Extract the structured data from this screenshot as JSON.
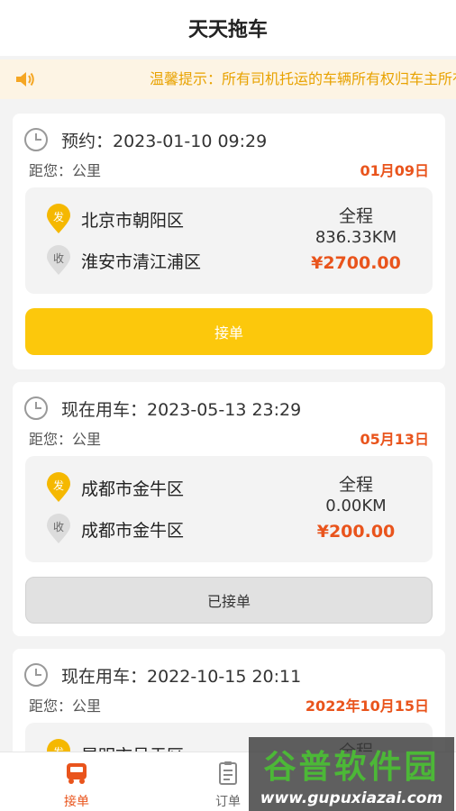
{
  "header": {
    "title": "天天拖车"
  },
  "notice": {
    "icon": "speaker-icon",
    "text": "温馨提示：所有司机托运的车辆所有权归车主所有"
  },
  "orders": [
    {
      "time": "预约：2023-01-10 09:29",
      "distance": "距您：公里",
      "date_badge": "01月09日",
      "from_tag": "发",
      "from": "北京市朝阳区",
      "to_tag": "收",
      "to": "淮安市清江浦区",
      "summary_label": "全程",
      "km": "836.33KM",
      "price": "¥2700.00",
      "button": "接单",
      "status": "accept"
    },
    {
      "time": "现在用车：2023-05-13 23:29",
      "distance": "距您：公里",
      "date_badge": "05月13日",
      "from_tag": "发",
      "from": "成都市金牛区",
      "to_tag": "收",
      "to": "成都市金牛区",
      "summary_label": "全程",
      "km": "0.00KM",
      "price": "¥200.00",
      "button": "已接单",
      "status": "taken"
    },
    {
      "time": "现在用车：2022-10-15 20:11",
      "distance": "距您：公里",
      "date_badge": "2022年10月15日",
      "from_tag": "发",
      "from": "昆明市呈贡区",
      "summary_label": "全程"
    }
  ],
  "tabbar": {
    "items": [
      {
        "label": "接单",
        "icon": "truck-icon",
        "active": true
      },
      {
        "label": "订单",
        "icon": "clipboard-icon",
        "active": false
      }
    ]
  },
  "colors": {
    "accent_yellow": "#fcc80c",
    "price_orange": "#e9541c",
    "notice_text": "#e8a200",
    "tab_active": "#e9541c"
  },
  "watermark": {
    "title": "谷普软件园",
    "url": "www.gupuxiazai.com"
  }
}
